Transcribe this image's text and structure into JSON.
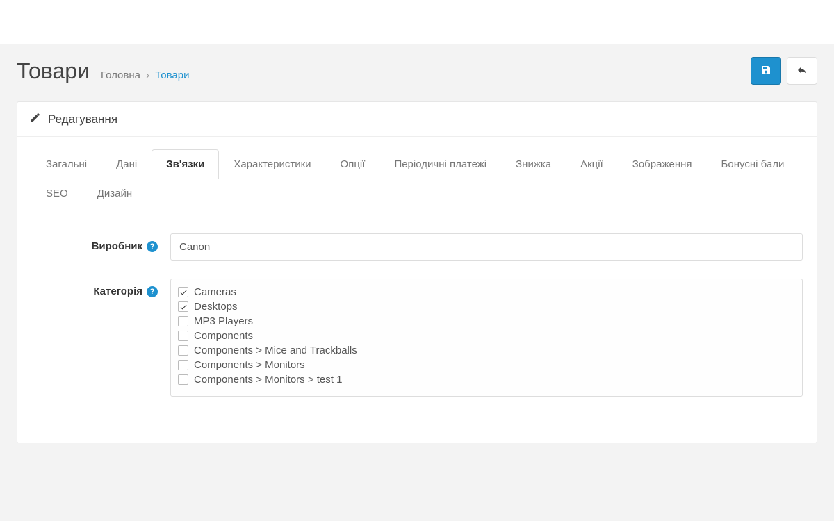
{
  "header": {
    "title": "Товари",
    "breadcrumb": {
      "home": "Головна",
      "separator": "›",
      "current": "Товари"
    }
  },
  "panel": {
    "heading": "Редагування"
  },
  "tabs": [
    {
      "label": "Загальні",
      "active": false
    },
    {
      "label": "Дані",
      "active": false
    },
    {
      "label": "Зв'язки",
      "active": true
    },
    {
      "label": "Характеристики",
      "active": false
    },
    {
      "label": "Опції",
      "active": false
    },
    {
      "label": "Періодичні платежі",
      "active": false
    },
    {
      "label": "Знижка",
      "active": false
    },
    {
      "label": "Акції",
      "active": false
    },
    {
      "label": "Зображення",
      "active": false
    },
    {
      "label": "Бонусні бали",
      "active": false
    },
    {
      "label": "SEO",
      "active": false
    },
    {
      "label": "Дизайн",
      "active": false
    }
  ],
  "form": {
    "manufacturer": {
      "label": "Виробник",
      "value": "Canon"
    },
    "category": {
      "label": "Категорія",
      "items": [
        {
          "label": "Cameras",
          "checked": true
        },
        {
          "label": "Desktops",
          "checked": true
        },
        {
          "label": "MP3 Players",
          "checked": false
        },
        {
          "label": "Components",
          "checked": false
        },
        {
          "label": "Components  >  Mice and Trackballs",
          "checked": false
        },
        {
          "label": "Components  >  Monitors",
          "checked": false
        },
        {
          "label": "Components  >  Monitors  >  test 1",
          "checked": false
        }
      ]
    }
  },
  "colors": {
    "primary": "#1e91cf"
  }
}
